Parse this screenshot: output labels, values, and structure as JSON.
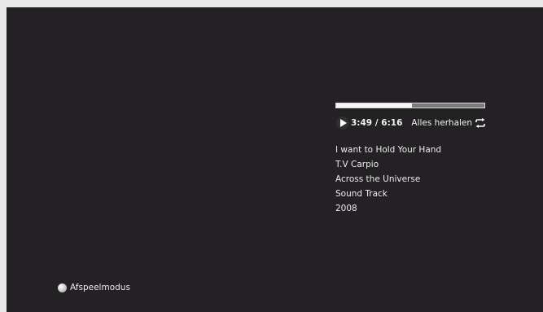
{
  "player": {
    "progress_fraction": 0.51,
    "time": "3:49 / 6:16",
    "repeat_label": "Alles herhalen",
    "icons": {
      "play": "play-icon",
      "repeat": "repeat-icon"
    }
  },
  "track": {
    "title": "I want to Hold Your Hand",
    "artist": "T.V Carpio",
    "album": "Across the Universe",
    "genre": "Sound Track",
    "year": "2008"
  },
  "footer": {
    "mode_label": "Afspeelmodus",
    "mode_icon": "circle-button-icon"
  },
  "colors": {
    "background": "#232123",
    "text": "#f2f2f2",
    "progress_fill": "#f6f6f6",
    "progress_track": "#7b7b7b"
  }
}
